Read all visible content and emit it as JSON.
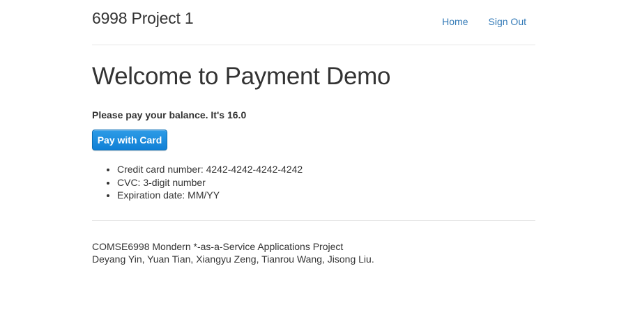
{
  "header": {
    "brand": "6998 Project 1",
    "nav": [
      {
        "label": "Home"
      },
      {
        "label": "Sign Out"
      }
    ],
    "link_color": "#337ab7"
  },
  "main": {
    "title": "Welcome to Payment Demo",
    "balance_text": "Please pay your balance. It's 16.0",
    "pay_button_label": "Pay with Card",
    "pay_button_color": "#1a8ad9",
    "info_items": [
      "Credit card number: 4242-4242-4242-4242",
      "CVC: 3-digit number",
      "Expiration date: MM/YY"
    ]
  },
  "footer": {
    "line1": "COMSE6998 Mondern *-as-a-Service Applications Project",
    "line2": "Deyang Yin, Yuan Tian, Xiangyu Zeng, Tianrou Wang, Jisong Liu."
  }
}
